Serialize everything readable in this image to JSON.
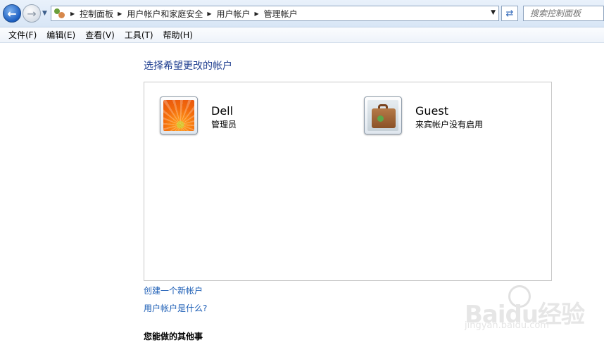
{
  "window": {
    "breadcrumbs": [
      "控制面板",
      "用户帐户和家庭安全",
      "用户帐户",
      "管理帐户"
    ],
    "search_placeholder": "搜索控制面板"
  },
  "menu": [
    "文件(F)",
    "编辑(E)",
    "查看(V)",
    "工具(T)",
    "帮助(H)"
  ],
  "main": {
    "heading": "选择希望更改的帐户",
    "accounts": [
      {
        "name": "Dell",
        "type": "管理员",
        "picture": "orange-flower-picture"
      },
      {
        "name": "Guest",
        "type": "来宾帐户没有启用",
        "picture": "suitcase-picture"
      }
    ],
    "links": [
      "创建一个新帐户",
      "用户帐户是什么?"
    ],
    "other_heading": "您能做的其他事"
  },
  "watermark": {
    "logo_text": "Baidu经验",
    "url": "jingyan.baidu.com"
  }
}
